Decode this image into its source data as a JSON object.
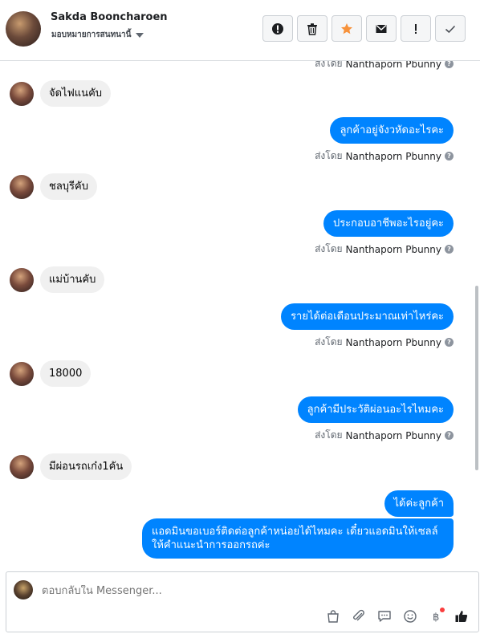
{
  "header": {
    "contact_name": "Sakda Booncharoen",
    "assign_label": "มอบหมายการสนทนานี้",
    "tools": [
      {
        "icon": "alert-circle-icon",
        "name": "mark-spam-button"
      },
      {
        "icon": "trash-icon",
        "name": "delete-button"
      },
      {
        "icon": "star-icon",
        "name": "star-button"
      },
      {
        "icon": "envelope-icon",
        "name": "mark-unread-button"
      },
      {
        "icon": "exclamation-icon",
        "name": "follow-up-button"
      },
      {
        "icon": "check-icon",
        "name": "mark-done-button"
      }
    ],
    "star_color": "#f7923b"
  },
  "thread": {
    "top_sent_by_prefix": "ส่งโดย",
    "top_sent_by_name": "Nanthaporn Pbunny",
    "messages": [
      {
        "dir": "in",
        "text": "จัดไฟแนคับ"
      },
      {
        "dir": "out",
        "text": "ลูกค้าอยู่จังวหัดอะไรคะ",
        "sent_by_prefix": "ส่งโดย",
        "sent_by_name": "Nanthaporn Pbunny"
      },
      {
        "dir": "in",
        "text": "ชลบุรีคับ"
      },
      {
        "dir": "out",
        "text": "ประกอบอาชีพอะไรอยู่คะ",
        "sent_by_prefix": "ส่งโดย",
        "sent_by_name": "Nanthaporn Pbunny"
      },
      {
        "dir": "in",
        "text": "แม่บ้านคับ"
      },
      {
        "dir": "out",
        "text": "รายได้ต่อเดือนประมาณเท่าไหร่คะ",
        "sent_by_prefix": "ส่งโดย",
        "sent_by_name": "Nanthaporn Pbunny"
      },
      {
        "dir": "in",
        "text": "18000"
      },
      {
        "dir": "out",
        "text": "ลูกค้ามีประวัติผ่อนอะไรไหมคะ",
        "sent_by_prefix": "ส่งโดย",
        "sent_by_name": "Nanthaporn Pbunny"
      },
      {
        "dir": "in",
        "text": "มีผ่อนรถเก๋ง1คัน"
      },
      {
        "dir": "out",
        "text": "ได้ค่ะลูกค้า"
      },
      {
        "dir": "out",
        "text": "แอดมินขอเบอร์ติดต่อลูกค้าหน่อยได้ไหมคะ เดี๋ยวแอดมินให้เซลล์ให้คำแนะนำการออกรถค่ะ"
      }
    ]
  },
  "composer": {
    "placeholder": "ตอบกลับใน Messenger...",
    "icons": [
      "shop-bag-icon",
      "paperclip-icon",
      "saved-reply-icon",
      "emoji-icon",
      "baht-payment-icon",
      "thumbs-up-icon"
    ],
    "accent": "#0084ff",
    "notification_dot_color": "#fa3e3e"
  }
}
